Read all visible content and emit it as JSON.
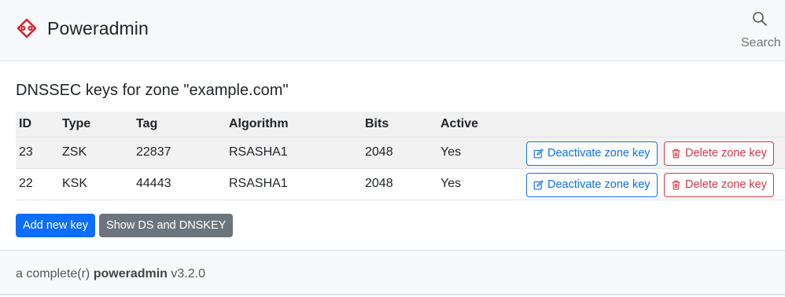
{
  "header": {
    "brand_name": "Poweradmin",
    "search_label": "Search"
  },
  "page": {
    "title": "DNSSEC keys for zone \"example.com\""
  },
  "table": {
    "columns": [
      "ID",
      "Type",
      "Tag",
      "Algorithm",
      "Bits",
      "Active"
    ],
    "rows": [
      {
        "id": "23",
        "type": "ZSK",
        "tag": "22837",
        "algorithm": "RSASHA1",
        "bits": "2048",
        "active": "Yes"
      },
      {
        "id": "22",
        "type": "KSK",
        "tag": "44443",
        "algorithm": "RSASHA1",
        "bits": "2048",
        "active": "Yes"
      }
    ],
    "deactivate_label": "Deactivate zone key",
    "delete_label": "Delete zone key"
  },
  "actions": {
    "add_label": "Add new key",
    "show_ds_label": "Show DS and DNSKEY"
  },
  "footer": {
    "prefix": "a complete(r)",
    "product": "poweradmin",
    "version": "v3.2.0"
  },
  "colors": {
    "primary": "#0d6efd",
    "danger": "#dc3545",
    "secondary": "#6c757d",
    "logo": "#d9232d"
  }
}
